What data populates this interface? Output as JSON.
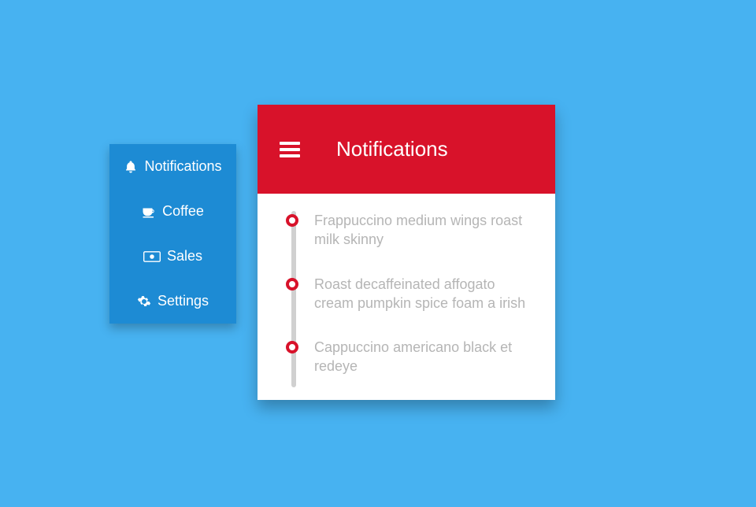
{
  "sidebar": {
    "items": [
      {
        "label": "Notifications",
        "icon": "bell-icon"
      },
      {
        "label": "Coffee",
        "icon": "coffee-icon"
      },
      {
        "label": "Sales",
        "icon": "money-icon"
      },
      {
        "label": "Settings",
        "icon": "gears-icon"
      }
    ]
  },
  "panel": {
    "title": "Notifications",
    "notifications": [
      {
        "text": "Frappuccino medium wings roast milk skinny"
      },
      {
        "text": "Roast decaffeinated affogato cream pumpkin spice foam a irish"
      },
      {
        "text": "Cappuccino americano black et redeye"
      }
    ]
  }
}
